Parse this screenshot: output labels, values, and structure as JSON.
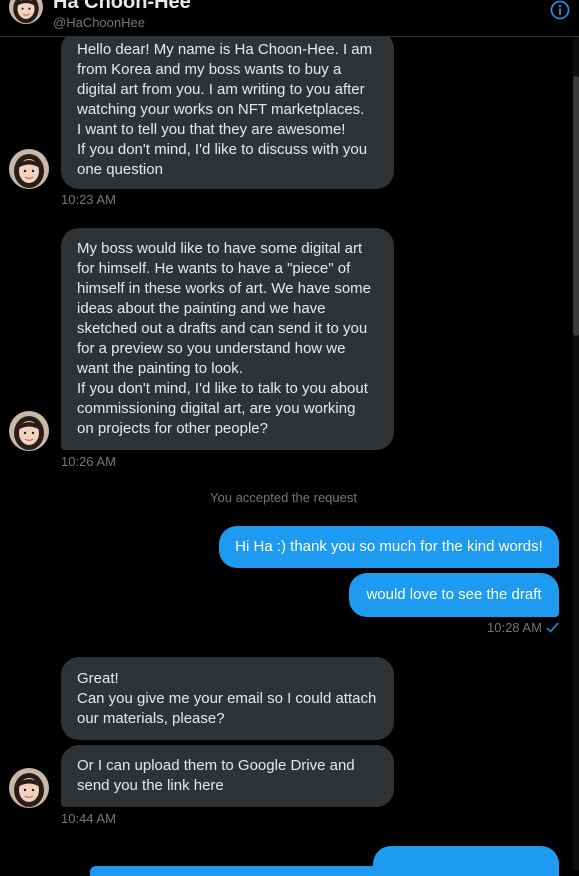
{
  "header": {
    "name": "Ha Choon-Hee",
    "handle": "@HaChoonHee",
    "info_icon": "info-icon"
  },
  "messages": {
    "m1": "Hello dear! My name is Ha Choon-Hee. I am\nfrom Korea and my boss wants to buy a\ndigital art from you. I am writing to you after\nwatching your works on NFT marketplaces.\nI want to tell you that they are awesome!\nIf you don't mind, I'd like to discuss with you\none question",
    "m1_time": "10:23 AM",
    "m2": "My boss would like to have some digital art\nfor himself. He wants to have a \"piece\" of\nhimself in these works of art. We have some\nideas about the painting and we have\nsketched out a drafts and can send it to you\nfor a preview so you understand how we\nwant the painting to look.\nIf you don't mind, I'd like to talk to you about\ncommissioning digital art, are you working\non projects for other people?",
    "m2_time": "10:26 AM",
    "system": "You accepted the request",
    "out1": "Hi Ha :) thank you so much for the kind words!",
    "out2": "would love to see the draft",
    "out_time": "10:28 AM",
    "m3": "Great!\nCan you give me your email so I could attach\nour materials, please?",
    "m4": "Or I can upload them to Google Drive and\nsend you the link here",
    "m4_time": "10:44 AM"
  },
  "colors": {
    "background": "#000000",
    "incoming_bubble": "#2f3336",
    "outgoing_bubble": "#1d9bf0",
    "muted_text": "#71767b",
    "accent": "#1d9bf0"
  }
}
